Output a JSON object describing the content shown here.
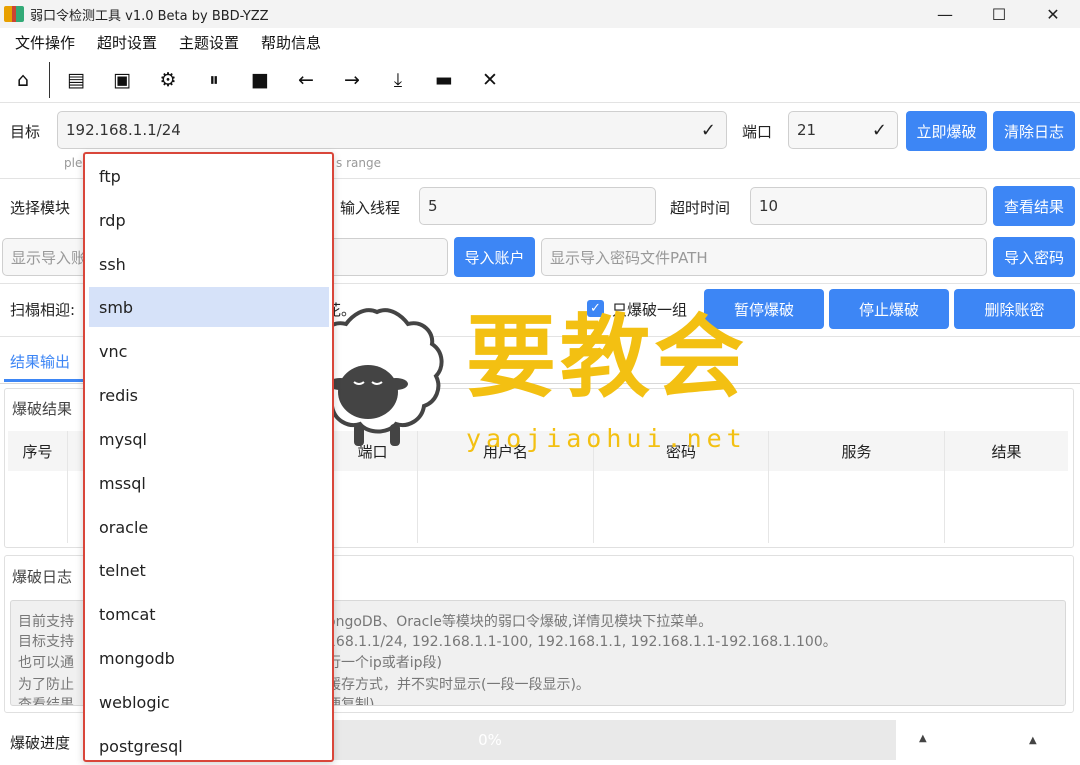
{
  "window": {
    "title": "弱口令检测工具 v1.0 Beta by BBD-YZZ",
    "controls": {
      "minimize": "—",
      "maximize": "☐",
      "close": "✕"
    }
  },
  "menu": [
    "文件操作",
    "超时设置",
    "主题设置",
    "帮助信息"
  ],
  "toolbar": {
    "icons": [
      "home-icon",
      "file-icon",
      "save-icon",
      "gear-icon",
      "pause-icon",
      "stop-icon",
      "arrow-left-icon",
      "arrow-right-icon",
      "download-icon",
      "trash-icon",
      "close-icon"
    ],
    "glyphs": [
      "⌂",
      "▤",
      "▣",
      "⚙",
      "⏸",
      "■",
      "←",
      "→",
      "⤓",
      "▬",
      "✕"
    ]
  },
  "target": {
    "label": "目标",
    "value": "192.168.1.1/24",
    "hint_left": "ple",
    "hint_right": "s range",
    "port_label": "端口",
    "port_value": "21",
    "check_glyph": "✓",
    "start_button": "立即爆破",
    "clear_button": "清除日志"
  },
  "module_row": {
    "label": "选择模块",
    "threads_label": "输入线程",
    "threads_value": "5",
    "timeout_label": "超时时间",
    "timeout_value": "10",
    "results_button": "查看结果"
  },
  "import_row": {
    "account_placeholder": "显示导入账",
    "account_button": "导入账户",
    "password_placeholder": "显示导入密码文件PATH",
    "password_button": "导入密码"
  },
  "scan_row": {
    "label": "扫榻相迎:",
    "trailing": "花。",
    "checkbox_label": "只爆破一组",
    "checkbox_checked": true,
    "pause_button": "暂停爆破",
    "stop_button": "停止爆破",
    "delete_button": "删除账密"
  },
  "tabs": {
    "active": "结果输出"
  },
  "results": {
    "group_title": "爆破结果",
    "columns": [
      "序号",
      "",
      "端口",
      "用户名",
      "密码",
      "服务",
      "结果"
    ]
  },
  "log": {
    "group_title": "爆破日志",
    "lines": [
      "目前支持",
      "目标支持",
      "也可以通",
      "为了防止",
      "查看结果"
    ],
    "lines_right": [
      "ongoDB、Oracle等模块的弱口令爆破,详情见模块下拉菜单。",
      "168.1.1/24, 192.168.1.1-100, 192.168.1.1, 192.168.1.1-192.168.1.100。",
      "行一个ip或者ip段)",
      "缓存方式，并不实时显示(一段一段显示)。",
      "便复制)"
    ]
  },
  "progress": {
    "label": "爆破进度",
    "value": 0,
    "text": "0%"
  },
  "module_dropdown": {
    "items": [
      "ftp",
      "rdp",
      "ssh",
      "smb",
      "vnc",
      "redis",
      "mysql",
      "mssql",
      "oracle",
      "telnet",
      "tomcat",
      "mongodb",
      "weblogic",
      "postgresql"
    ],
    "selected": "smb"
  },
  "watermark": {
    "text": "要教会",
    "url": "yaojiaohui.net",
    "color": "#f3c012"
  }
}
